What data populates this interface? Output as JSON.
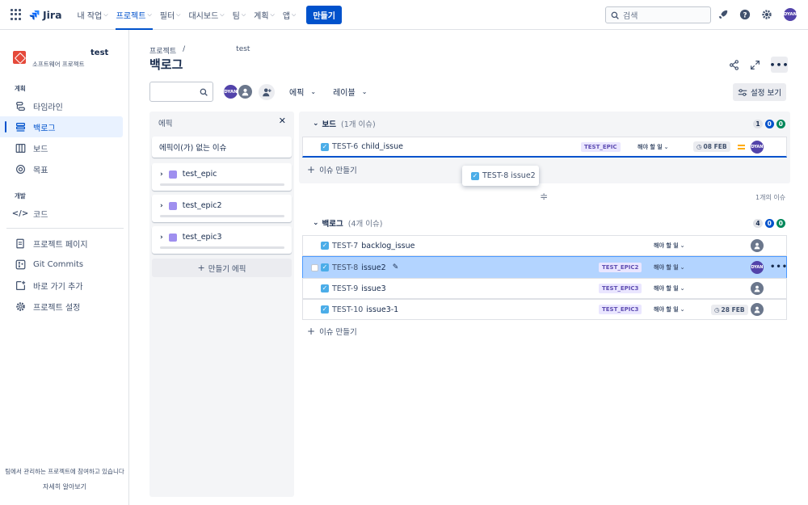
{
  "topnav": {
    "logo_text": "Jira",
    "items": [
      {
        "label": "내 작업"
      },
      {
        "label": "프로젝트"
      },
      {
        "label": "필터"
      },
      {
        "label": "대시보드"
      },
      {
        "label": "팀"
      },
      {
        "label": "계획"
      },
      {
        "label": "앱"
      }
    ],
    "create_label": "만들기",
    "search_placeholder": "검색",
    "user_initials": "DYAN"
  },
  "sidebar": {
    "project_name": "test",
    "project_type": "소프트웨어 프로젝트",
    "section_plan": "계획",
    "section_dev": "개발",
    "items": [
      {
        "label": "타임라인"
      },
      {
        "label": "백로그"
      },
      {
        "label": "보드"
      },
      {
        "label": "목표"
      },
      {
        "label": "코드"
      },
      {
        "label": "프로젝트 페이지"
      },
      {
        "label": "Git Commits"
      },
      {
        "label": "바로 가기 추가"
      },
      {
        "label": "프로젝트 설정"
      }
    ],
    "footer_text": "팀에서 관리하는 프로젝트에 참여하고 있습니다",
    "footer_link": "자세히 알아보기"
  },
  "main": {
    "breadcrumb": [
      "프로젝트",
      "/",
      "test"
    ],
    "title": "백로그",
    "filters": {
      "avatar_initials": "DYAN",
      "epic_label": "에픽",
      "label_label": "레이블",
      "view_settings": "설정 보기"
    }
  },
  "epic_panel": {
    "title": "에픽",
    "no_epic": "에픽이(가) 없는 이슈",
    "epics": [
      {
        "name": "test_epic"
      },
      {
        "name": "test_epic2"
      },
      {
        "name": "test_epic3"
      }
    ],
    "create_label": "만들기 에픽"
  },
  "board": {
    "title": "보드",
    "count": "(1개 이슈)",
    "pills": [
      "1",
      "0",
      "0"
    ],
    "issues": [
      {
        "key": "TEST-6",
        "summary": "child_issue",
        "epic": "TEST_EPIC",
        "status": "해야 할 일",
        "due": "08 FEB",
        "assignee": "DYAN"
      }
    ],
    "create_issue": "이슈 만들기",
    "drag_card": "TEST-8 issue2",
    "issue_count_note": "1개의 이슈"
  },
  "backlog": {
    "title": "백로그",
    "count": "(4개 이슈)",
    "pills": [
      "4",
      "0",
      "0"
    ],
    "issues": [
      {
        "key": "TEST-7",
        "summary": "backlog_issue",
        "epic": "",
        "status": "해야 할 일",
        "due": ""
      },
      {
        "key": "TEST-8",
        "summary": "issue2",
        "epic": "TEST_EPIC2",
        "status": "해야 할 일",
        "due": "",
        "assignee": "DYAN"
      },
      {
        "key": "TEST-9",
        "summary": "issue3",
        "epic": "TEST_EPIC3",
        "status": "해야 할 일",
        "due": ""
      },
      {
        "key": "TEST-10",
        "summary": "issue3-1",
        "epic": "TEST_EPIC3",
        "status": "해야 할 일",
        "due": "28 FEB"
      }
    ],
    "create_issue": "이슈 만들기"
  }
}
